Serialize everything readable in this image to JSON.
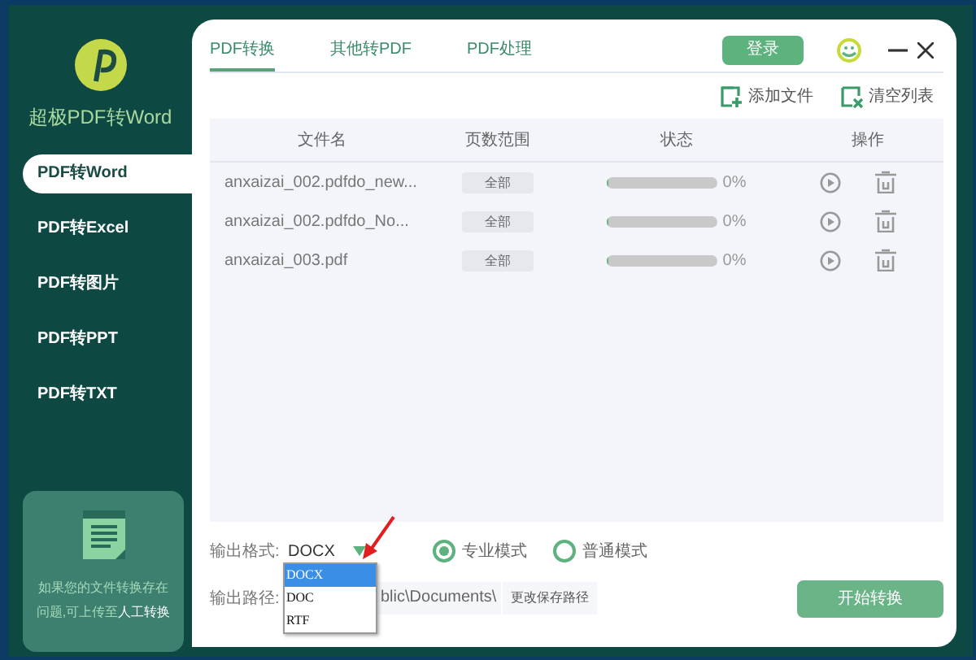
{
  "app": {
    "title": "超极PDF转Word"
  },
  "sidebar": {
    "items": [
      {
        "label": "PDF转Word",
        "selected": true
      },
      {
        "label": "PDF转Excel",
        "selected": false
      },
      {
        "label": "PDF转图片",
        "selected": false
      },
      {
        "label": "PDF转PPT",
        "selected": false
      },
      {
        "label": "PDF转TXT",
        "selected": false
      }
    ],
    "help": {
      "text": "如果您的文件转换存在问题,可上传至",
      "link": "人工转换"
    }
  },
  "tabs": [
    {
      "label": "PDF转换",
      "selected": true
    },
    {
      "label": "其他转PDF",
      "selected": false
    },
    {
      "label": "PDF处理",
      "selected": false
    }
  ],
  "login_button": "登录",
  "toolbar": [
    "添加文件",
    "清空列表"
  ],
  "table": {
    "columns": [
      "文件名",
      "页数范围",
      "状态",
      "操作"
    ],
    "rows": [
      {
        "file": "anxaizai_002.pdfdo_new...",
        "range": "全部",
        "level": 0,
        "reading": "0%"
      },
      {
        "file": "anxaizai_002.pdfdo_No...",
        "range": "全部",
        "level": 0,
        "reading": "0%"
      },
      {
        "file": "anxaizai_003.pdf",
        "range": "全部",
        "level": 0,
        "reading": "0%"
      }
    ]
  },
  "output": {
    "format_label": "输出格式:",
    "format_value": "DOCX",
    "format_options": [
      {
        "label": "DOCX",
        "selected": true
      },
      {
        "label": "DOC",
        "selected": false
      },
      {
        "label": "RTF",
        "selected": false
      }
    ],
    "modes": [
      {
        "label": "专业模式",
        "selected": true
      },
      {
        "label": "普通模式",
        "selected": false
      }
    ],
    "path_label": "输出路径:",
    "path_value": "blic\\Documents\\",
    "change_path_button": "更改保存路径"
  },
  "start_button": "开始转换"
}
